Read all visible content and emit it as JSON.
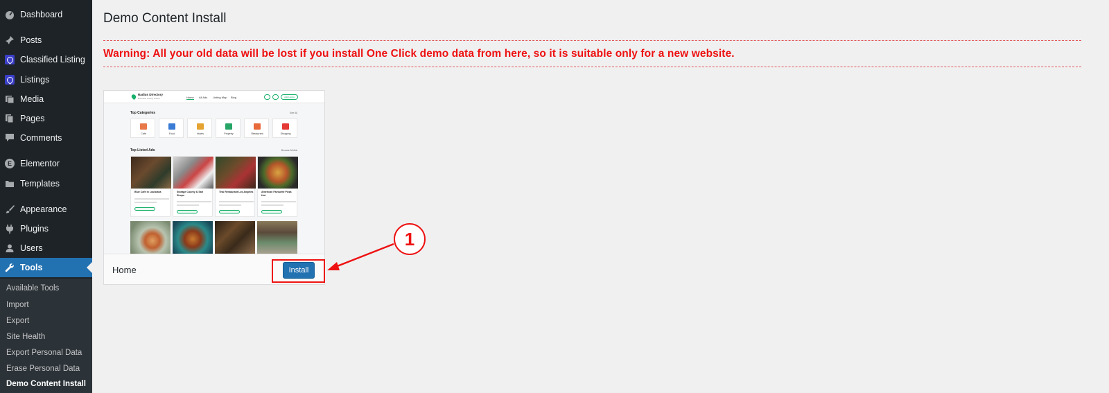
{
  "sidebar": {
    "items": [
      {
        "label": "Dashboard",
        "icon": "dashboard-icon"
      },
      {
        "label": "Posts",
        "icon": "pin-icon"
      },
      {
        "label": "Classified Listing",
        "icon": "classified-listing-icon"
      },
      {
        "label": "Listings",
        "icon": "listings-icon"
      },
      {
        "label": "Media",
        "icon": "media-icon"
      },
      {
        "label": "Pages",
        "icon": "pages-icon"
      },
      {
        "label": "Comments",
        "icon": "comment-icon"
      },
      {
        "label": "Elementor",
        "icon": "elementor-icon"
      },
      {
        "label": "Templates",
        "icon": "folder-icon"
      },
      {
        "label": "Appearance",
        "icon": "brush-icon"
      },
      {
        "label": "Plugins",
        "icon": "plugin-icon"
      },
      {
        "label": "Users",
        "icon": "user-icon"
      },
      {
        "label": "Tools",
        "icon": "wrench-icon",
        "active": true
      }
    ],
    "submenu": [
      {
        "label": "Available Tools"
      },
      {
        "label": "Import"
      },
      {
        "label": "Export"
      },
      {
        "label": "Site Health"
      },
      {
        "label": "Export Personal Data"
      },
      {
        "label": "Erase Personal Data"
      },
      {
        "label": "Demo Content Install",
        "current": true
      }
    ]
  },
  "main": {
    "title": "Demo Content Install",
    "warning": "Warning: All your old data will be lost if you install One Click demo data from here, so it is suitable only for a new website.",
    "warning_color": "#ee1111"
  },
  "demo": {
    "name": "Home",
    "install_label": "Install",
    "preview": {
      "logo_title": "Radius Directory",
      "logo_subtitle": "Business Listing Theme",
      "nav": [
        "Home",
        "All Ads",
        "Listing Map",
        "Blog"
      ],
      "add_listing": "Add Listing",
      "top_categories_heading": "Top Categories",
      "categories_see_all": "See All",
      "categories": [
        "Cafe",
        "Food",
        "Hotels",
        "Property",
        "Restaurant",
        "Shopping"
      ],
      "top_ads_heading": "Top Listed Ads",
      "ads_browse_all": "Browse All Ads",
      "ads": [
        "Blue Cafe In Louisiana",
        "Storage County & Sari Shops",
        "Thai Restaurant Los Angeles",
        "American Favourite Pizza Hut"
      ]
    }
  },
  "annotation": {
    "step_number": "1",
    "color": "#ee1111"
  }
}
